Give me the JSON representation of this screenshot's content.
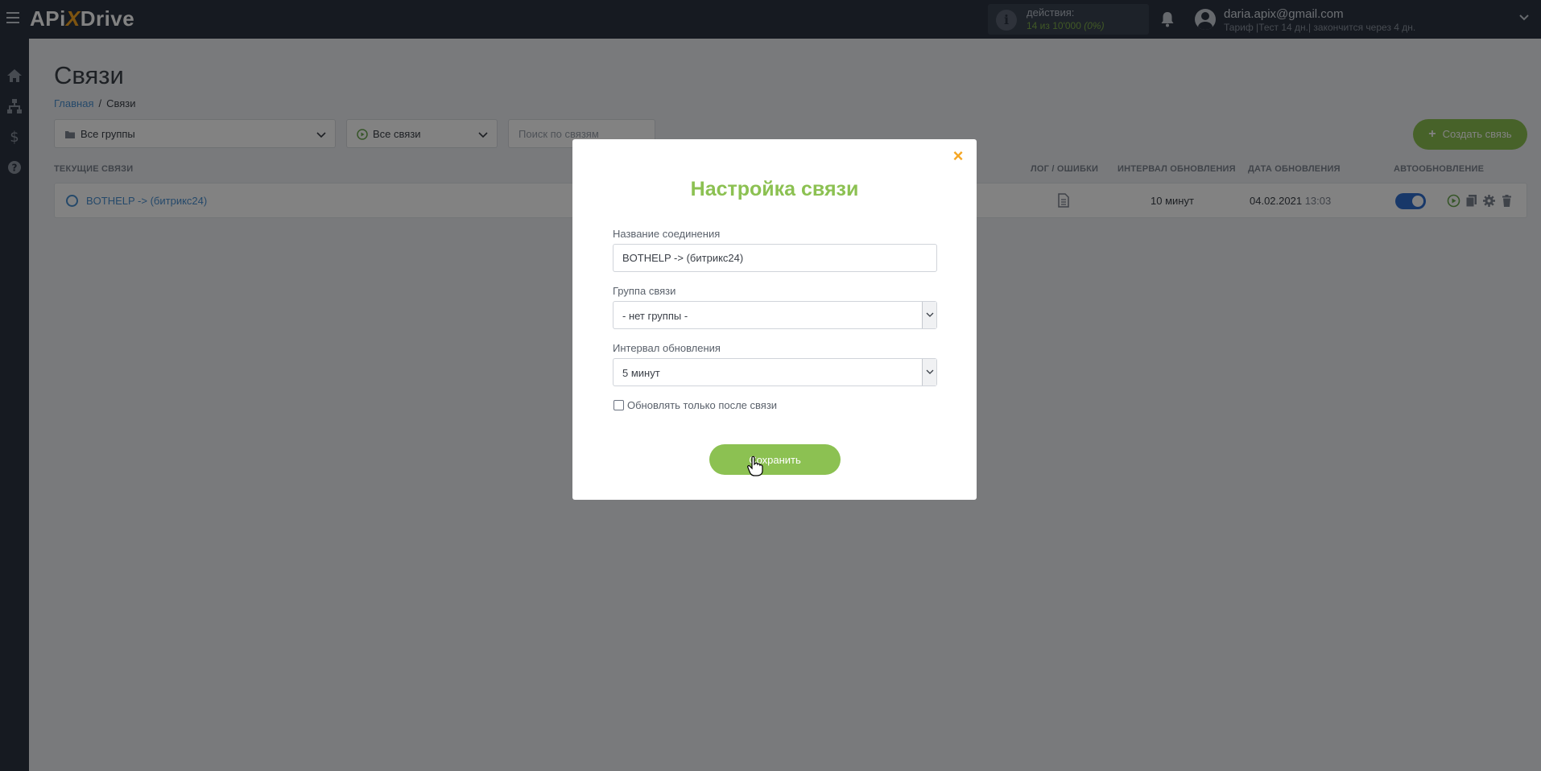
{
  "header": {
    "logo_left": "APi",
    "logo_x": "X",
    "logo_right": "Drive",
    "actions_label": "действия:",
    "actions_count": "14 из 10'000",
    "actions_percent": "(0%)",
    "user_email": "daria.apix@gmail.com",
    "user_plan": "Тариф |Тест 14 дн.| закончится через 4 дн."
  },
  "page": {
    "title": "Связи",
    "breadcrumb_home": "Главная",
    "breadcrumb_sep": "/",
    "breadcrumb_current": "Связи"
  },
  "filters": {
    "group_select": "Все группы",
    "connection_select": "Все связи",
    "search_placeholder": "Поиск по связям",
    "create_button": "Создать связь",
    "create_plus": "+"
  },
  "table": {
    "columns": {
      "current": "Текущие связи",
      "log": "Лог / Ошибки",
      "interval": "Интервал обновления",
      "date": "Дата обновления",
      "auto": "Автообновление"
    },
    "rows": [
      {
        "name": "BOTHELP -> (битрикс24)",
        "interval": "10 минут",
        "date": "04.02.2021",
        "time": "13:03",
        "auto_enabled": true
      }
    ]
  },
  "modal": {
    "close": "×",
    "title": "Настройка связи",
    "name_label": "Название соединения",
    "name_value": "BOTHELP -> (битрикс24)",
    "group_label": "Группа связи",
    "group_value": "- нет группы -",
    "interval_label": "Интервал обновления",
    "interval_value": "5 минут",
    "checkbox_label": "Обновлять только после связи",
    "checkbox_checked": false,
    "save_button": "Сохранить"
  },
  "colors": {
    "topbar": "#2b3341",
    "accent_green": "#8cc152",
    "link_blue": "#4a8fd1",
    "toggle_blue": "#2f6ecf",
    "close_orange": "#f5a623"
  }
}
